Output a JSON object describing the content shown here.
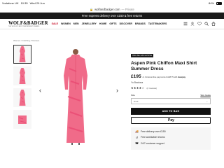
{
  "status_bar": {
    "carrier": "Vodafone UK",
    "time": "10:35",
    "date": "Wed 29 Jun",
    "battery": "84%"
  },
  "url_bar": {
    "domain": "wolfandbadger.com",
    "mode": "Private"
  },
  "promo": {
    "text": "Free express delivery over £150 & free returns"
  },
  "header": {
    "logo_main": "WOLF&BADGER",
    "logo_sub": "THE WORLD'S BEST INDEPENDENT BRANDS",
    "nav": [
      "SALE",
      "WOMEN",
      "MEN",
      "JEWELLERY",
      "HOME",
      "GIFTS",
      "DISCOVER",
      "BRANDS",
      "TASTEMAKERS"
    ],
    "icons": [
      "hamburger-icon",
      "user-icon",
      "heart-icon",
      "search-icon",
      "bag-icon"
    ]
  },
  "breadcrumb": "Women / Clothing / Dresses",
  "gallery": {
    "thumb_count": 4,
    "main_color": "#f06b89",
    "accent_color": "#ea4a73"
  },
  "product": {
    "badge": "ONLINE EXCLUSIVE",
    "title": "Aspen Pink Chiffon Maxi Shirt Summer Dress",
    "price": "£195",
    "installments": "or 4 interest-free payments of £48.75 with",
    "clearpay": "clearpay",
    "brand": "Yo Baalona",
    "stars": "★★★★☆",
    "rating_value": 4,
    "reviews": "(2 reviews)",
    "size_label": "Size",
    "size_guide": "Size Guide",
    "size_value": "8 UK",
    "add_to_bag": "ADD TO BAG",
    "apple_pay": "Pay",
    "apple_logo": "",
    "benefits": [
      "Free delivery over £150",
      "Free worldwide returns",
      "24/7 customer support"
    ]
  }
}
